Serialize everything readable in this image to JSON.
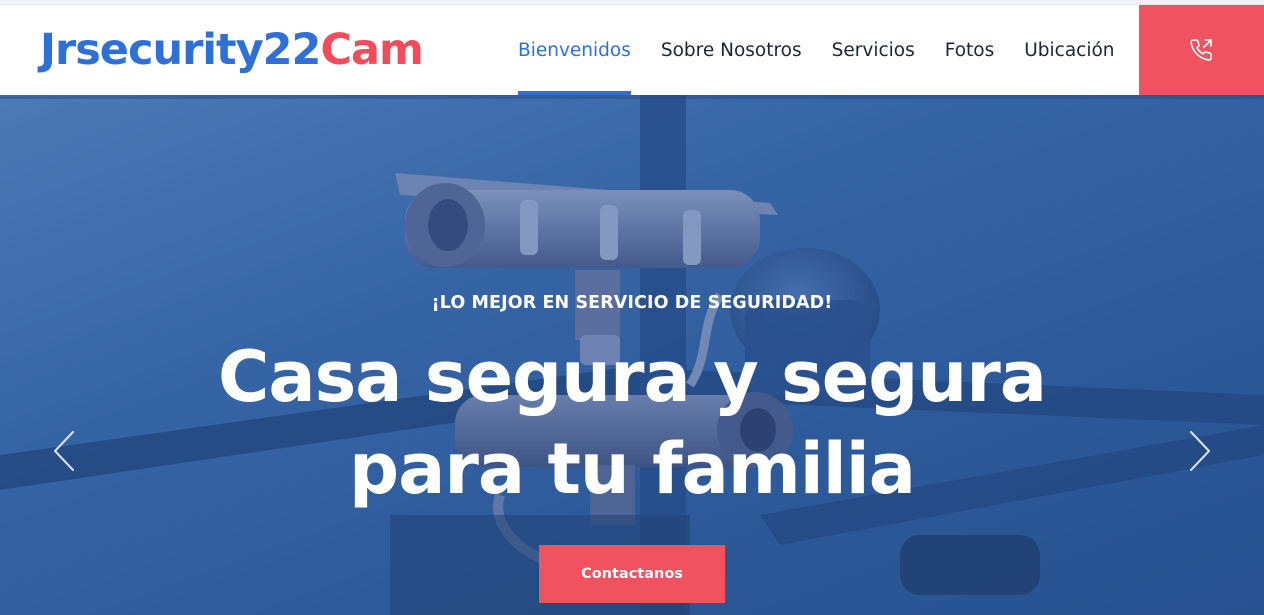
{
  "brand": {
    "name_part1": "Jrsecurity22",
    "name_part2": "Cam"
  },
  "nav": {
    "items": [
      {
        "label": "Bienvenidos",
        "active": true
      },
      {
        "label": "Sobre Nosotros",
        "active": false
      },
      {
        "label": "Servicios",
        "active": false
      },
      {
        "label": "Fotos",
        "active": false
      },
      {
        "label": "Ubicación",
        "active": false
      }
    ],
    "call_icon": "phone-outgoing-icon"
  },
  "hero": {
    "eyebrow": "¡LO MEJOR EN SERVICIO DE SEGURIDAD!",
    "headline_line1": "Casa segura y segura",
    "headline_line2": "para tu familia",
    "cta_label": "Contactanos",
    "prev_icon": "chevron-left-icon",
    "next_icon": "chevron-right-icon",
    "background_image": "security-cameras-photo"
  },
  "colors": {
    "primary_blue": "#2f6fd8",
    "accent_red": "#f1525f",
    "nav_text": "#1b2538",
    "hero_overlay": "#2f5b98"
  }
}
